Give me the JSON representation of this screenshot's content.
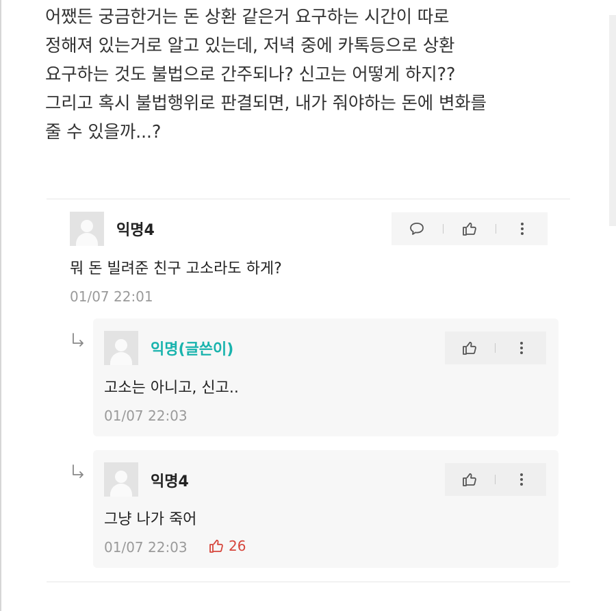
{
  "post": {
    "lines": [
      "어쨌든 궁금한거는 돈 상환 같은거 요구하는 시간이 따로",
      "정해져 있는거로 알고 있는데, 저녁 중에 카톡등으로 상환",
      "요구하는 것도 불법으로 간주되나? 신고는 어떻게 하지??",
      "그리고 혹시 불법행위로 판결되면, 내가 줘야하는 돈에 변화를",
      "줄 수 있을까...?"
    ]
  },
  "comments": [
    {
      "author": "익명4",
      "text": "뭐 돈 빌려준 친구 고소라도 하게?",
      "time": "01/07 22:01",
      "actions": [
        "comment-icon",
        "thumbs-up-icon",
        "more-vertical-icon"
      ]
    }
  ],
  "replies": [
    {
      "author": "익명(글쓴이)",
      "text": "고소는 아니고, 신고..",
      "time": "01/07 22:03",
      "actions": [
        "thumbs-up-icon",
        "more-vertical-icon"
      ]
    },
    {
      "author": "익명4",
      "text": "그냥 나가 죽어",
      "time": "01/07 22:03",
      "likes": "26",
      "actions": [
        "thumbs-up-icon",
        "more-vertical-icon"
      ]
    }
  ],
  "colors": {
    "op_author": "#19b3ad",
    "like_red": "#d6463c",
    "timestamp": "#9a9a9a",
    "action_bg": "#f5f5f5"
  }
}
